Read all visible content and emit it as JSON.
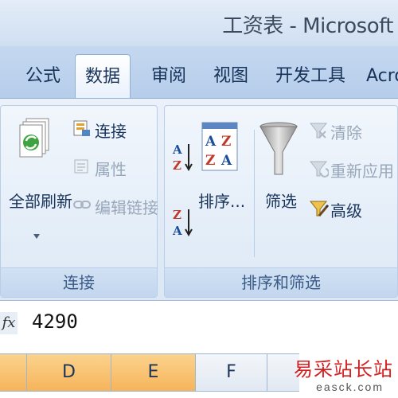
{
  "window": {
    "title": "工资表 - Microsoft"
  },
  "tabs": [
    "公式",
    "数据",
    "审阅",
    "视图",
    "开发工具",
    "Acro"
  ],
  "active_tab": "数据",
  "ribbon": {
    "connections_group": {
      "label": "连接",
      "refresh_all": "全部刷新",
      "connections": "连接",
      "properties": "属性",
      "edit_links": "编辑链接"
    },
    "sort_filter_group": {
      "label": "排序和筛选",
      "sort": "排序...",
      "filter": "筛选",
      "clear": "清除",
      "reapply": "重新应用",
      "advanced": "高级"
    }
  },
  "formula_bar": {
    "fx_label": "fx",
    "value": "4290"
  },
  "columns": [
    "D",
    "E",
    "F"
  ],
  "selected_columns": [
    "D",
    "E"
  ],
  "watermark": {
    "text": "易采站长站",
    "url": "easck.com"
  }
}
